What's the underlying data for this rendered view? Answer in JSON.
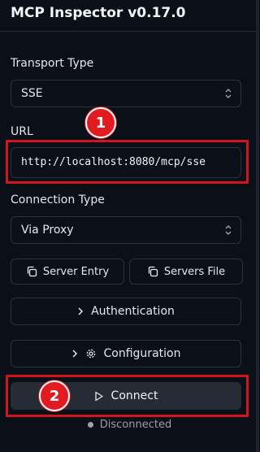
{
  "app": {
    "title": "MCP Inspector v0.17.0"
  },
  "transport": {
    "label": "Transport Type",
    "value": "SSE"
  },
  "url": {
    "label": "URL",
    "value": "http://localhost:8080/mcp/sse"
  },
  "connection": {
    "label": "Connection Type",
    "value": "Via Proxy"
  },
  "buttons": {
    "server_entry": "Server Entry",
    "servers_file": "Servers File",
    "authentication": "Authentication",
    "configuration": "Configuration",
    "connect": "Connect"
  },
  "annotations": {
    "badge1": "1",
    "badge2": "2",
    "highlight_color": "#d3151b"
  },
  "status": {
    "text": "Disconnected"
  },
  "icons": [
    "chevrons-up-down-icon",
    "copy-icon",
    "chevron-right-icon",
    "gear-icon",
    "play-icon"
  ]
}
